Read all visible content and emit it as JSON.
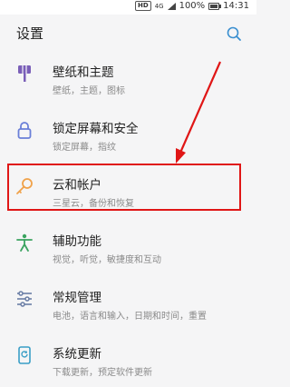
{
  "status_bar": {
    "hd": "HD",
    "network": "4G",
    "battery": "100%",
    "time": "14:31"
  },
  "header": {
    "title": "设置"
  },
  "items": [
    {
      "label": "壁纸和主题",
      "sub": "壁纸，主题，图标",
      "icon": "paint-roller-icon",
      "icon_color": "#7a5fb8"
    },
    {
      "label": "锁定屏幕和安全",
      "sub": "锁定屏幕，指纹",
      "icon": "lock-icon",
      "icon_color": "#6a7fd8"
    },
    {
      "label": "云和帐户",
      "sub": "三星云，备份和恢复",
      "icon": "key-icon",
      "icon_color": "#f0a24a"
    },
    {
      "label": "辅助功能",
      "sub": "视觉，听觉，敏捷度和互动",
      "icon": "accessibility-icon",
      "icon_color": "#3aa35f"
    },
    {
      "label": "常规管理",
      "sub": "电池，语言和输入，日期和时间，重置",
      "icon": "sliders-icon",
      "icon_color": "#6a7ea6"
    },
    {
      "label": "系统更新",
      "sub": "下载更新，预定软件更新",
      "icon": "update-icon",
      "icon_color": "#3a9ec6"
    }
  ],
  "annotation": {
    "highlight_color": "#e01616"
  }
}
